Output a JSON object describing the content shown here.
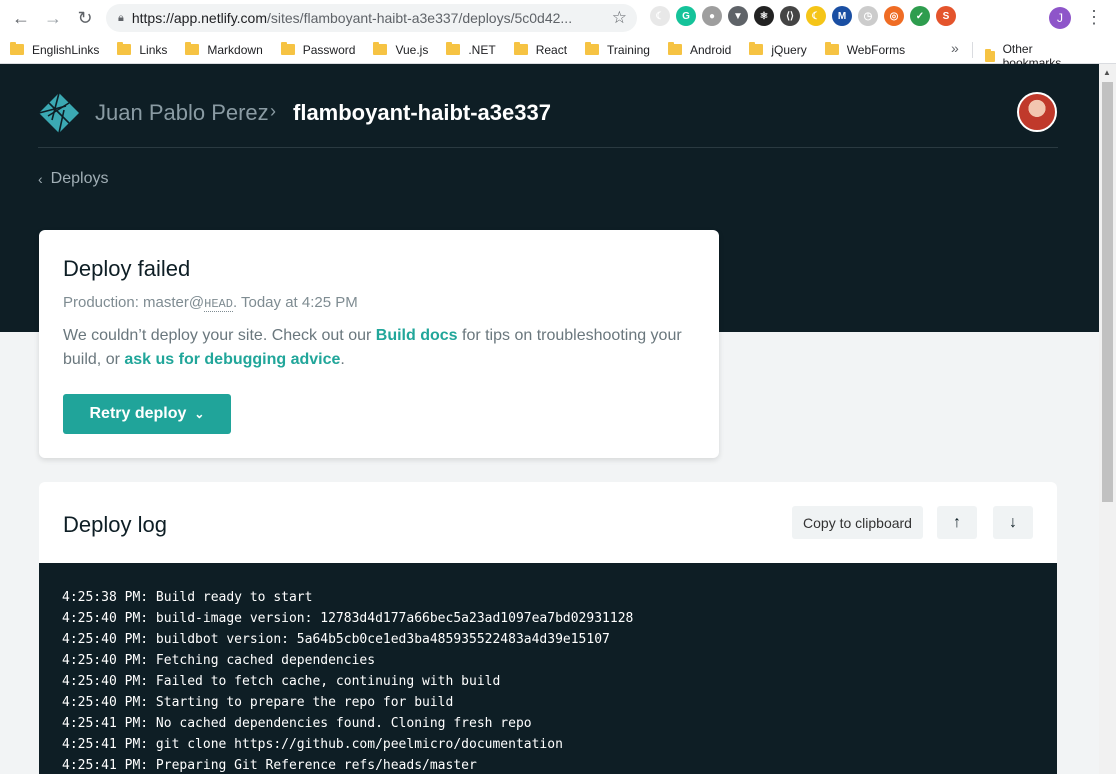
{
  "browser": {
    "url_host": "https://app.netlify.com",
    "url_path": "/sites/flamboyant-haibt-a3e337/deploys/5c0d42...",
    "profile_initial": "J",
    "bookmarks": [
      "EnglishLinks",
      "Links",
      "Markdown",
      "Password",
      "Vue.js",
      ".NET",
      "React",
      "Training",
      "Android",
      "jQuery",
      "WebForms"
    ],
    "bookmarks_more": "»",
    "other_bookmarks": "Other bookmarks",
    "extensions": [
      {
        "name": "wolf-extension-icon",
        "color": "#e8e8e8",
        "glyph": "☾"
      },
      {
        "name": "grammarly-icon",
        "color": "#15c39a",
        "glyph": "G"
      },
      {
        "name": "circle-extension-icon",
        "color": "#9e9e9e",
        "glyph": "●"
      },
      {
        "name": "vue-devtools-icon",
        "color": "#5f6368",
        "glyph": "▼"
      },
      {
        "name": "react-devtools-icon",
        "color": "#222222",
        "glyph": "⚛"
      },
      {
        "name": "code-extension-icon",
        "color": "#444444",
        "glyph": "⟨⟩"
      },
      {
        "name": "moon-extension-icon",
        "color": "#f5c518",
        "glyph": "☾"
      },
      {
        "name": "m-extension-icon",
        "color": "#1a4fa3",
        "glyph": "M"
      },
      {
        "name": "clock-extension-icon",
        "color": "#cccccc",
        "glyph": "◷"
      },
      {
        "name": "lifebuoy-extension-icon",
        "color": "#ef6c24",
        "glyph": "◎"
      },
      {
        "name": "check-extension-icon",
        "color": "#2e9d4e",
        "glyph": "✓"
      },
      {
        "name": "s-extension-icon",
        "color": "#e4542c",
        "glyph": "S"
      }
    ]
  },
  "header": {
    "team_name": "Juan Pablo Perez",
    "site_name": "flamboyant-haibt-a3e337",
    "back_label": "Deploys"
  },
  "deploy_card": {
    "title": "Deploy failed",
    "meta_prefix": "Production: master@",
    "meta_head": "HEAD",
    "meta_suffix": ". Today at 4:25 PM",
    "desc_part1": "We couldn’t deploy your site. Check out our ",
    "desc_link1": "Build docs",
    "desc_part2": " for tips on troubleshooting your build, or ",
    "desc_link2": "ask us for debugging advice",
    "desc_part3": ".",
    "retry_label": "Retry deploy"
  },
  "deploy_log": {
    "title": "Deploy log",
    "copy_label": "Copy to clipboard",
    "scroll_top_label": "↑",
    "scroll_bottom_label": "↓",
    "lines": [
      "4:25:38 PM: Build ready to start",
      "4:25:40 PM: build-image version: 12783d4d177a66bec5a23ad1097ea7bd02931128",
      "4:25:40 PM: buildbot version: 5a64b5cb0ce1ed3ba485935522483a4d39e15107",
      "4:25:40 PM: Fetching cached dependencies",
      "4:25:40 PM: Failed to fetch cache, continuing with build",
      "4:25:40 PM: Starting to prepare the repo for build",
      "4:25:41 PM: No cached dependencies found. Cloning fresh repo",
      "4:25:41 PM: git clone https://github.com/peelmicro/documentation",
      "4:25:41 PM: Preparing Git Reference refs/heads/master"
    ]
  }
}
